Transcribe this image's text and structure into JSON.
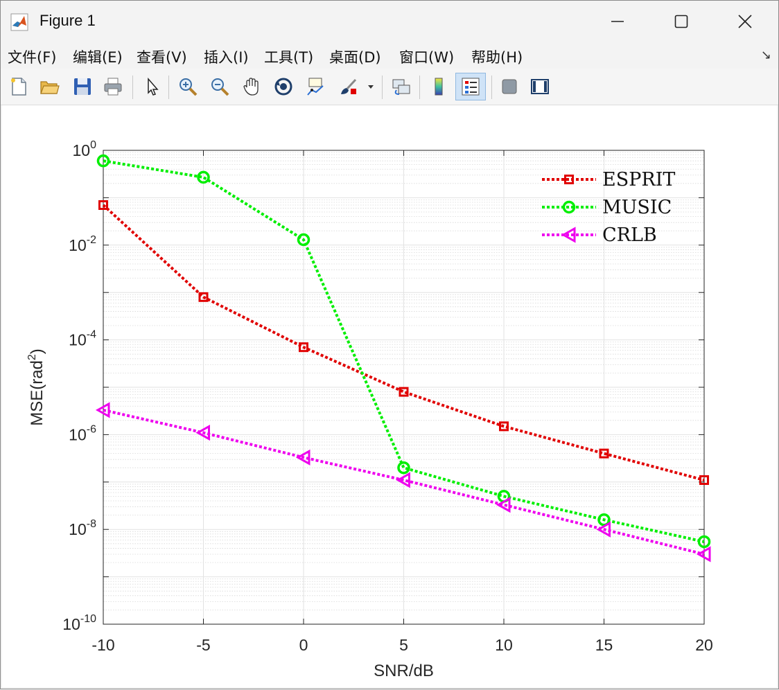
{
  "window": {
    "title": "Figure 1"
  },
  "menu": [
    "文件(F)",
    "编辑(E)",
    "查看(V)",
    "插入(I)",
    "工具(T)",
    "桌面(D)",
    "窗口(W)",
    "帮助(H)"
  ],
  "toolbar_icons": [
    "new-file-icon",
    "open-folder-icon",
    "save-icon",
    "print-icon",
    "pointer-icon",
    "zoom-in-icon",
    "zoom-out-icon",
    "pan-hand-icon",
    "rotate-3d-icon",
    "data-tips-icon",
    "brush-icon",
    "link-plot-icon",
    "colorbar-icon",
    "legend-icon",
    "hide-plot-tools-icon",
    "show-plot-tools-icon"
  ],
  "chart_data": {
    "type": "line",
    "xlabel": "SNR/dB",
    "ylabel": "MSE(rad²)",
    "ylabel_base": "MSE(rad",
    "ylabel_sup": "2",
    "ylabel_end": ")",
    "yscale": "log",
    "xlim": [
      -10,
      20
    ],
    "ylim": [
      1e-10,
      1
    ],
    "grid": true,
    "minor_grid": true,
    "legend_position": "top-right",
    "x": [
      -10,
      -5,
      0,
      5,
      10,
      15,
      20
    ],
    "x_ticks": [
      "-10",
      "-5",
      "0",
      "5",
      "10",
      "15",
      "20"
    ],
    "y_ticks": [
      {
        "base": "10",
        "exp": "0"
      },
      {
        "base": "10",
        "exp": "-2"
      },
      {
        "base": "10",
        "exp": "-4"
      },
      {
        "base": "10",
        "exp": "-6"
      },
      {
        "base": "10",
        "exp": "-8"
      },
      {
        "base": "10",
        "exp": "-10"
      }
    ],
    "series": [
      {
        "name": "ESPRIT",
        "color": "#e00000",
        "marker": "square",
        "values": [
          0.07,
          0.0008,
          7e-05,
          8e-06,
          1.5e-06,
          4e-07,
          1.1e-07
        ]
      },
      {
        "name": "MUSIC",
        "color": "#00ee00",
        "marker": "circle",
        "values": [
          0.6,
          0.27,
          0.013,
          2e-07,
          5e-08,
          1.6e-08,
          5.5e-09
        ]
      },
      {
        "name": "CRLB",
        "color": "#ee00ee",
        "marker": "triangle-left",
        "values": [
          3.3e-06,
          1.1e-06,
          3.3e-07,
          1.1e-07,
          3.3e-08,
          1e-08,
          3e-09
        ]
      }
    ]
  }
}
